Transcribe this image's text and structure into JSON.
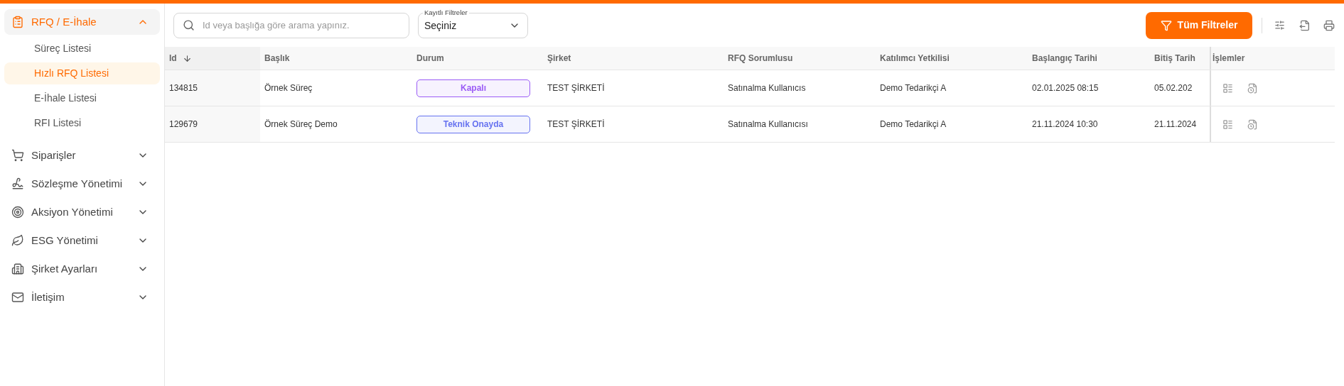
{
  "sidebar": {
    "items": [
      {
        "label": "RFQ / E-İhale",
        "expanded": true,
        "active": true,
        "children": [
          {
            "label": "Süreç Listesi",
            "selected": false
          },
          {
            "label": "Hızlı RFQ Listesi",
            "selected": true
          },
          {
            "label": "E-İhale Listesi",
            "selected": false
          },
          {
            "label": "RFI Listesi",
            "selected": false
          }
        ]
      },
      {
        "label": "Siparişler",
        "expanded": false,
        "active": false
      },
      {
        "label": "Sözleşme Yönetimi",
        "expanded": false,
        "active": false
      },
      {
        "label": "Aksiyon Yönetimi",
        "expanded": false,
        "active": false
      },
      {
        "label": "ESG Yönetimi",
        "expanded": false,
        "active": false
      },
      {
        "label": "Şirket Ayarları",
        "expanded": false,
        "active": false
      },
      {
        "label": "İletişim",
        "expanded": false,
        "active": false
      }
    ]
  },
  "search": {
    "placeholder": "Id veya başlığa göre arama yapınız."
  },
  "saved_filters": {
    "label": "Kayıtlı Filtreler",
    "value": "Seçiniz"
  },
  "all_filters_button": "Tüm Filtreler",
  "table": {
    "columns": [
      {
        "label": "Id",
        "sorted": true
      },
      {
        "label": "Başlık",
        "sorted": false
      },
      {
        "label": "Durum",
        "sorted": false
      },
      {
        "label": "Şirket",
        "sorted": false
      },
      {
        "label": "RFQ Sorumlusu",
        "sorted": false
      },
      {
        "label": "Katılımcı Yetkilisi",
        "sorted": false
      },
      {
        "label": "Başlangıç Tarihi",
        "sorted": false
      },
      {
        "label": "Bitiş Tarih",
        "sorted": false
      },
      {
        "label": "İşlemler",
        "sorted": false
      }
    ],
    "rows": [
      {
        "id": "134815",
        "title": "Örnek Süreç",
        "status": {
          "label": "Kapalı",
          "color": "#9b5cf6"
        },
        "company": "TEST ŞİRKETİ",
        "owner": "Satınalma Kullanıcıs",
        "participant": "Demo Tedarikçi A",
        "start": "02.01.2025 08:15",
        "end": "05.02.202"
      },
      {
        "id": "129679",
        "title": "Örnek Süreç Demo",
        "status": {
          "label": "Teknik Onayda",
          "color": "#6672f0"
        },
        "company": "TEST ŞİRKETİ",
        "owner": "Satınalma Kullanıcısı",
        "participant": "Demo Tedarikçi A",
        "start": "21.11.2024 10:30",
        "end": "21.11.2024"
      }
    ]
  }
}
